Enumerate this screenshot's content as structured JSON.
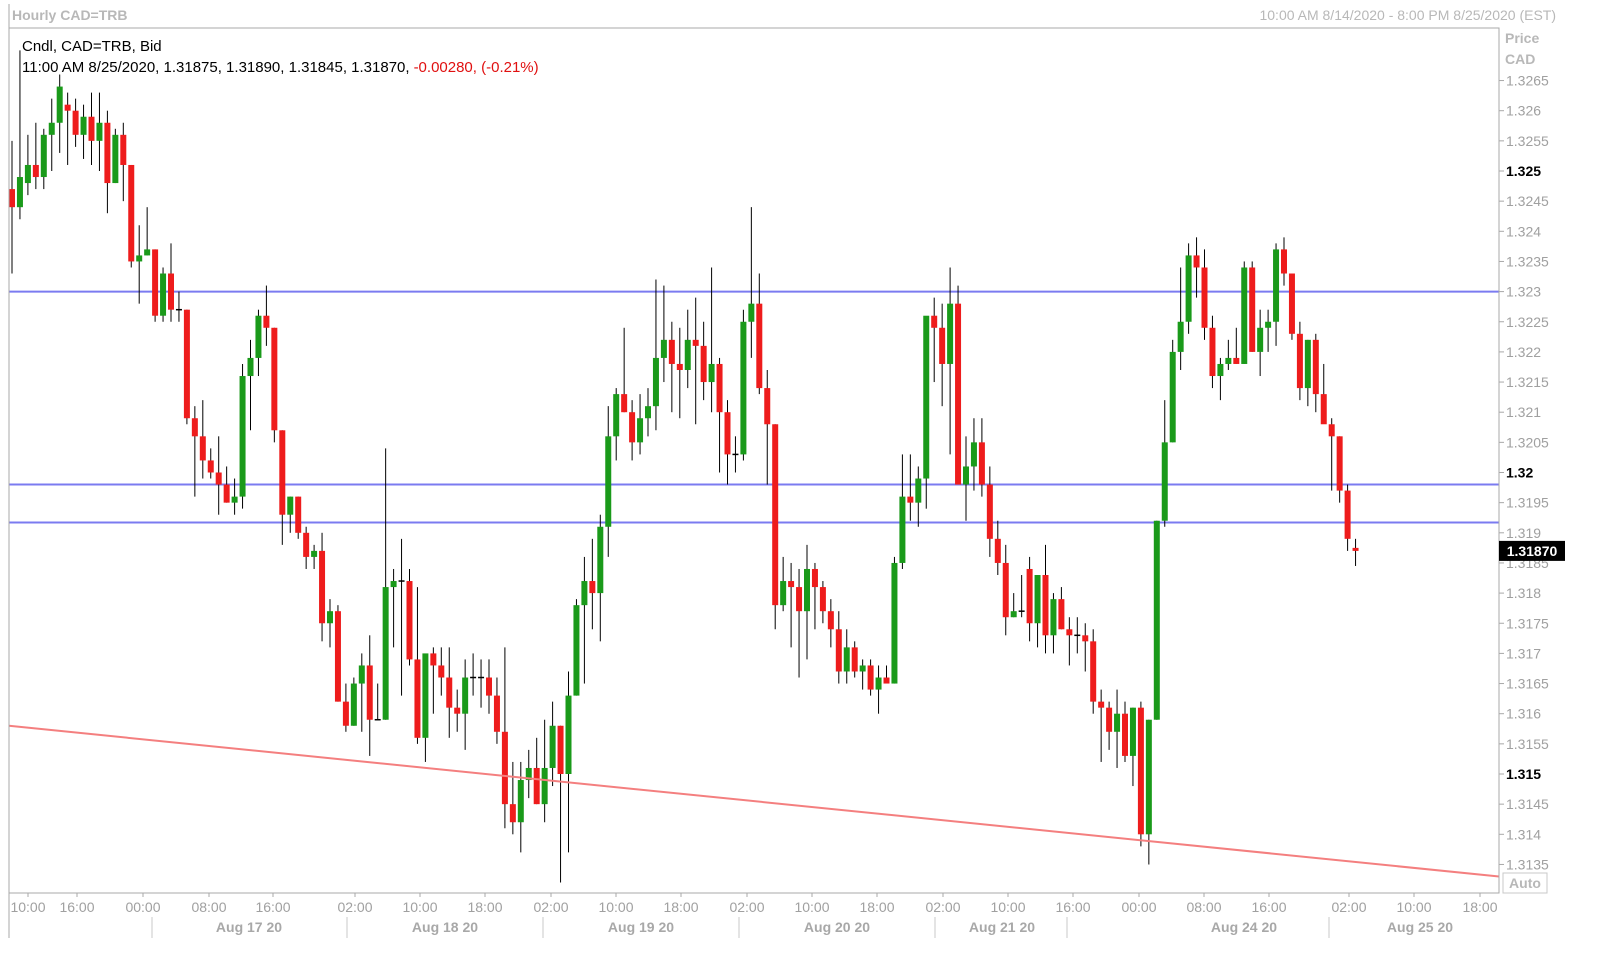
{
  "header": {
    "title": "Hourly CAD=TRB",
    "range": "10:00 AM 8/14/2020 - 8:00 PM 8/25/2020 (EST)"
  },
  "info": {
    "line1": "Cndl, CAD=TRB, Bid",
    "line2_main": "11:00 AM 8/25/2020, 1.31875, 1.31890, 1.31845, 1.31870,",
    "line2_change": "-0.00280, (-0.21%)"
  },
  "price_axis": {
    "title1": "Price",
    "title2": "CAD",
    "ticks": [
      "1.3265",
      "1.326",
      "1.3255",
      "1.325",
      "1.3245",
      "1.324",
      "1.3235",
      "1.323",
      "1.3225",
      "1.322",
      "1.3215",
      "1.321",
      "1.3205",
      "1.32",
      "1.3195",
      "1.319",
      "1.3185",
      "1.318",
      "1.3175",
      "1.317",
      "1.3165",
      "1.316",
      "1.3155",
      "1.315",
      "1.3145",
      "1.314",
      "1.3135"
    ],
    "bold_ticks": [
      "1.325",
      "1.32",
      "1.315"
    ],
    "last_price": "1.31870",
    "auto_label": "Auto"
  },
  "time_axis": {
    "hour_labels": [
      "10:00",
      "16:00",
      "00:00",
      "08:00",
      "16:00",
      "02:00",
      "10:00",
      "18:00",
      "02:00",
      "10:00",
      "18:00",
      "02:00",
      "10:00",
      "18:00",
      "02:00",
      "10:00",
      "16:00",
      "00:00",
      "08:00",
      "16:00",
      "02:00",
      "10:00",
      "18:00"
    ],
    "date_labels": [
      "Aug 17 20",
      "Aug 18 20",
      "Aug 19 20",
      "Aug 20 20",
      "Aug 21 20",
      "Aug 24 20",
      "Aug 25 20"
    ]
  },
  "colors": {
    "up": "#1a9a1a",
    "down": "#ee1c1c",
    "support_resistance": "#7b7bf0",
    "trendline": "#f47f7f",
    "change_text": "#e01010"
  },
  "chart_data": {
    "type": "candlestick",
    "title": "Hourly CAD=TRB",
    "ylabel": "Price CAD",
    "ylim": [
      1.3129,
      1.3273
    ],
    "series_name": "CAD=TRB",
    "candles": [
      {
        "o": 1.3247,
        "h": 1.3255,
        "l": 1.3233,
        "c": 1.3244
      },
      {
        "o": 1.3244,
        "h": 1.327,
        "l": 1.3242,
        "c": 1.3249
      },
      {
        "o": 1.3248,
        "h": 1.3256,
        "l": 1.3246,
        "c": 1.3251
      },
      {
        "o": 1.3251,
        "h": 1.3258,
        "l": 1.3247,
        "c": 1.3249
      },
      {
        "o": 1.3249,
        "h": 1.3257,
        "l": 1.3247,
        "c": 1.3256
      },
      {
        "o": 1.3256,
        "h": 1.3262,
        "l": 1.325,
        "c": 1.3258
      },
      {
        "o": 1.3258,
        "h": 1.3266,
        "l": 1.3253,
        "c": 1.3264
      },
      {
        "o": 1.3261,
        "h": 1.3263,
        "l": 1.3251,
        "c": 1.326
      },
      {
        "o": 1.326,
        "h": 1.3262,
        "l": 1.3254,
        "c": 1.3256
      },
      {
        "o": 1.3256,
        "h": 1.3261,
        "l": 1.3252,
        "c": 1.3259
      },
      {
        "o": 1.3259,
        "h": 1.3263,
        "l": 1.3251,
        "c": 1.3255
      },
      {
        "o": 1.3255,
        "h": 1.3263,
        "l": 1.325,
        "c": 1.3258
      },
      {
        "o": 1.3258,
        "h": 1.326,
        "l": 1.3243,
        "c": 1.3248
      },
      {
        "o": 1.3248,
        "h": 1.3257,
        "l": 1.3248,
        "c": 1.3256
      },
      {
        "o": 1.3256,
        "h": 1.3258,
        "l": 1.3245,
        "c": 1.3251
      },
      {
        "o": 1.3251,
        "h": 1.3251,
        "l": 1.3234,
        "c": 1.3235
      },
      {
        "o": 1.3235,
        "h": 1.3241,
        "l": 1.3228,
        "c": 1.3236
      },
      {
        "o": 1.3236,
        "h": 1.3244,
        "l": 1.3236,
        "c": 1.3237
      },
      {
        "o": 1.3237,
        "h": 1.3237,
        "l": 1.3225,
        "c": 1.3226
      },
      {
        "o": 1.3226,
        "h": 1.3234,
        "l": 1.3225,
        "c": 1.3233
      },
      {
        "o": 1.3233,
        "h": 1.3238,
        "l": 1.3225,
        "c": 1.3227
      },
      {
        "o": 1.3227,
        "h": 1.323,
        "l": 1.3225,
        "c": 1.3227
      },
      {
        "o": 1.3227,
        "h": 1.3227,
        "l": 1.3208,
        "c": 1.3209
      },
      {
        "o": 1.3209,
        "h": 1.3211,
        "l": 1.3196,
        "c": 1.3206
      },
      {
        "o": 1.3206,
        "h": 1.3212,
        "l": 1.3199,
        "c": 1.3202
      },
      {
        "o": 1.3202,
        "h": 1.3204,
        "l": 1.3199,
        "c": 1.32
      },
      {
        "o": 1.32,
        "h": 1.3206,
        "l": 1.3193,
        "c": 1.3198
      },
      {
        "o": 1.3198,
        "h": 1.3201,
        "l": 1.3195,
        "c": 1.3195
      },
      {
        "o": 1.3195,
        "h": 1.3199,
        "l": 1.3193,
        "c": 1.3196
      },
      {
        "o": 1.3196,
        "h": 1.3218,
        "l": 1.3194,
        "c": 1.3216
      },
      {
        "o": 1.3216,
        "h": 1.3222,
        "l": 1.3207,
        "c": 1.3219
      },
      {
        "o": 1.3219,
        "h": 1.3227,
        "l": 1.3216,
        "c": 1.3226
      },
      {
        "o": 1.3226,
        "h": 1.3231,
        "l": 1.3221,
        "c": 1.3224
      },
      {
        "o": 1.3224,
        "h": 1.3224,
        "l": 1.3205,
        "c": 1.3207
      },
      {
        "o": 1.3207,
        "h": 1.3207,
        "l": 1.3188,
        "c": 1.3193
      },
      {
        "o": 1.3193,
        "h": 1.3196,
        "l": 1.319,
        "c": 1.3196
      },
      {
        "o": 1.3196,
        "h": 1.3196,
        "l": 1.3189,
        "c": 1.319
      },
      {
        "o": 1.319,
        "h": 1.3191,
        "l": 1.3184,
        "c": 1.3186
      },
      {
        "o": 1.3186,
        "h": 1.3188,
        "l": 1.3184,
        "c": 1.3187
      },
      {
        "o": 1.3187,
        "h": 1.319,
        "l": 1.3172,
        "c": 1.3175
      },
      {
        "o": 1.3175,
        "h": 1.3179,
        "l": 1.3171,
        "c": 1.3177
      },
      {
        "o": 1.3177,
        "h": 1.3178,
        "l": 1.3162,
        "c": 1.3162
      },
      {
        "o": 1.3162,
        "h": 1.3165,
        "l": 1.3157,
        "c": 1.3158
      },
      {
        "o": 1.3158,
        "h": 1.3166,
        "l": 1.3158,
        "c": 1.3165
      },
      {
        "o": 1.3165,
        "h": 1.317,
        "l": 1.3157,
        "c": 1.3168
      },
      {
        "o": 1.3168,
        "h": 1.3173,
        "l": 1.3153,
        "c": 1.3159
      },
      {
        "o": 1.3159,
        "h": 1.3165,
        "l": 1.3159,
        "c": 1.3159
      },
      {
        "o": 1.3159,
        "h": 1.3204,
        "l": 1.3159,
        "c": 1.3181
      },
      {
        "o": 1.3181,
        "h": 1.3184,
        "l": 1.3171,
        "c": 1.3182
      },
      {
        "o": 1.3182,
        "h": 1.3189,
        "l": 1.3163,
        "c": 1.3182
      },
      {
        "o": 1.3182,
        "h": 1.3184,
        "l": 1.3168,
        "c": 1.3169
      },
      {
        "o": 1.3169,
        "h": 1.3181,
        "l": 1.3155,
        "c": 1.3156
      },
      {
        "o": 1.3156,
        "h": 1.3169,
        "l": 1.3152,
        "c": 1.317
      },
      {
        "o": 1.317,
        "h": 1.3171,
        "l": 1.316,
        "c": 1.3168
      },
      {
        "o": 1.3168,
        "h": 1.3171,
        "l": 1.3163,
        "c": 1.3166
      },
      {
        "o": 1.3166,
        "h": 1.3171,
        "l": 1.3156,
        "c": 1.3161
      },
      {
        "o": 1.3161,
        "h": 1.3164,
        "l": 1.3157,
        "c": 1.316
      },
      {
        "o": 1.316,
        "h": 1.3169,
        "l": 1.3154,
        "c": 1.3166
      },
      {
        "o": 1.3166,
        "h": 1.317,
        "l": 1.3163,
        "c": 1.3166
      },
      {
        "o": 1.3166,
        "h": 1.3169,
        "l": 1.3161,
        "c": 1.3166
      },
      {
        "o": 1.3166,
        "h": 1.3169,
        "l": 1.316,
        "c": 1.3163
      },
      {
        "o": 1.3163,
        "h": 1.3166,
        "l": 1.3155,
        "c": 1.3157
      },
      {
        "o": 1.3157,
        "h": 1.3171,
        "l": 1.3141,
        "c": 1.3145
      },
      {
        "o": 1.3145,
        "h": 1.3152,
        "l": 1.314,
        "c": 1.3142
      },
      {
        "o": 1.3142,
        "h": 1.3152,
        "l": 1.3137,
        "c": 1.3149
      },
      {
        "o": 1.3149,
        "h": 1.3154,
        "l": 1.3146,
        "c": 1.3151
      },
      {
        "o": 1.3151,
        "h": 1.3156,
        "l": 1.3145,
        "c": 1.3145
      },
      {
        "o": 1.3145,
        "h": 1.3159,
        "l": 1.3142,
        "c": 1.3151
      },
      {
        "o": 1.3151,
        "h": 1.3162,
        "l": 1.3148,
        "c": 1.3158
      },
      {
        "o": 1.3158,
        "h": 1.3158,
        "l": 1.3132,
        "c": 1.315
      },
      {
        "o": 1.315,
        "h": 1.3167,
        "l": 1.3137,
        "c": 1.3163
      },
      {
        "o": 1.3163,
        "h": 1.3179,
        "l": 1.3163,
        "c": 1.3178
      },
      {
        "o": 1.3178,
        "h": 1.3186,
        "l": 1.3165,
        "c": 1.3182
      },
      {
        "o": 1.3182,
        "h": 1.3189,
        "l": 1.3174,
        "c": 1.318
      },
      {
        "o": 1.318,
        "h": 1.3193,
        "l": 1.3172,
        "c": 1.3191
      },
      {
        "o": 1.3191,
        "h": 1.3211,
        "l": 1.3186,
        "c": 1.3206
      },
      {
        "o": 1.3206,
        "h": 1.3214,
        "l": 1.3202,
        "c": 1.3213
      },
      {
        "o": 1.3213,
        "h": 1.3224,
        "l": 1.321,
        "c": 1.321
      },
      {
        "o": 1.321,
        "h": 1.3212,
        "l": 1.3202,
        "c": 1.3205
      },
      {
        "o": 1.3205,
        "h": 1.3213,
        "l": 1.3203,
        "c": 1.3209
      },
      {
        "o": 1.3209,
        "h": 1.3214,
        "l": 1.3206,
        "c": 1.3211
      },
      {
        "o": 1.3211,
        "h": 1.3232,
        "l": 1.3207,
        "c": 1.3219
      },
      {
        "o": 1.3219,
        "h": 1.3231,
        "l": 1.3215,
        "c": 1.3222
      },
      {
        "o": 1.3222,
        "h": 1.3225,
        "l": 1.321,
        "c": 1.3218
      },
      {
        "o": 1.3218,
        "h": 1.3224,
        "l": 1.3209,
        "c": 1.3217
      },
      {
        "o": 1.3217,
        "h": 1.3227,
        "l": 1.3214,
        "c": 1.3222
      },
      {
        "o": 1.3222,
        "h": 1.3229,
        "l": 1.3208,
        "c": 1.3221
      },
      {
        "o": 1.3221,
        "h": 1.3225,
        "l": 1.3212,
        "c": 1.3215
      },
      {
        "o": 1.3215,
        "h": 1.3234,
        "l": 1.321,
        "c": 1.3218
      },
      {
        "o": 1.3218,
        "h": 1.3219,
        "l": 1.32,
        "c": 1.321
      },
      {
        "o": 1.321,
        "h": 1.3212,
        "l": 1.3198,
        "c": 1.3203
      },
      {
        "o": 1.3203,
        "h": 1.3206,
        "l": 1.32,
        "c": 1.3203
      },
      {
        "o": 1.3203,
        "h": 1.3227,
        "l": 1.3202,
        "c": 1.3225
      },
      {
        "o": 1.3225,
        "h": 1.3244,
        "l": 1.3219,
        "c": 1.3228
      },
      {
        "o": 1.3228,
        "h": 1.3233,
        "l": 1.3213,
        "c": 1.3214
      },
      {
        "o": 1.3214,
        "h": 1.3217,
        "l": 1.3198,
        "c": 1.3208
      },
      {
        "o": 1.3208,
        "h": 1.3208,
        "l": 1.3174,
        "c": 1.3178
      },
      {
        "o": 1.3178,
        "h": 1.3186,
        "l": 1.3177,
        "c": 1.3182
      },
      {
        "o": 1.3182,
        "h": 1.3185,
        "l": 1.3171,
        "c": 1.3181
      },
      {
        "o": 1.3181,
        "h": 1.3184,
        "l": 1.3166,
        "c": 1.3177
      },
      {
        "o": 1.3177,
        "h": 1.3188,
        "l": 1.3169,
        "c": 1.3184
      },
      {
        "o": 1.3184,
        "h": 1.3185,
        "l": 1.3174,
        "c": 1.3181
      },
      {
        "o": 1.3181,
        "h": 1.3182,
        "l": 1.3175,
        "c": 1.3177
      },
      {
        "o": 1.3177,
        "h": 1.3179,
        "l": 1.3171,
        "c": 1.3174
      },
      {
        "o": 1.3174,
        "h": 1.3177,
        "l": 1.3165,
        "c": 1.3167
      },
      {
        "o": 1.3167,
        "h": 1.3174,
        "l": 1.3165,
        "c": 1.3171
      },
      {
        "o": 1.3171,
        "h": 1.3172,
        "l": 1.3166,
        "c": 1.3167
      },
      {
        "o": 1.3167,
        "h": 1.3169,
        "l": 1.3164,
        "c": 1.3168
      },
      {
        "o": 1.3168,
        "h": 1.3169,
        "l": 1.3163,
        "c": 1.3164
      },
      {
        "o": 1.3164,
        "h": 1.3168,
        "l": 1.316,
        "c": 1.3166
      },
      {
        "o": 1.3166,
        "h": 1.3168,
        "l": 1.3165,
        "c": 1.3165
      },
      {
        "o": 1.3165,
        "h": 1.3186,
        "l": 1.3165,
        "c": 1.3185
      },
      {
        "o": 1.3185,
        "h": 1.3203,
        "l": 1.3184,
        "c": 1.3196
      },
      {
        "o": 1.3196,
        "h": 1.3203,
        "l": 1.3192,
        "c": 1.3195
      },
      {
        "o": 1.3195,
        "h": 1.3201,
        "l": 1.3191,
        "c": 1.3199
      },
      {
        "o": 1.3199,
        "h": 1.3214,
        "l": 1.3194,
        "c": 1.3226
      },
      {
        "o": 1.3226,
        "h": 1.3229,
        "l": 1.3215,
        "c": 1.3224
      },
      {
        "o": 1.3224,
        "h": 1.3228,
        "l": 1.3211,
        "c": 1.3218
      },
      {
        "o": 1.3218,
        "h": 1.3234,
        "l": 1.3203,
        "c": 1.3228
      },
      {
        "o": 1.3228,
        "h": 1.3231,
        "l": 1.3198,
        "c": 1.3198
      },
      {
        "o": 1.3198,
        "h": 1.3206,
        "l": 1.3192,
        "c": 1.3201
      },
      {
        "o": 1.3201,
        "h": 1.3209,
        "l": 1.3197,
        "c": 1.3205
      },
      {
        "o": 1.3205,
        "h": 1.3209,
        "l": 1.3196,
        "c": 1.3198
      },
      {
        "o": 1.3198,
        "h": 1.3201,
        "l": 1.3186,
        "c": 1.3189
      },
      {
        "o": 1.3189,
        "h": 1.3192,
        "l": 1.3183,
        "c": 1.3185
      },
      {
        "o": 1.3185,
        "h": 1.3188,
        "l": 1.3173,
        "c": 1.3176
      },
      {
        "o": 1.3176,
        "h": 1.318,
        "l": 1.3176,
        "c": 1.3177
      },
      {
        "o": 1.3177,
        "h": 1.3183,
        "l": 1.3176,
        "c": 1.3177
      },
      {
        "o": 1.3184,
        "h": 1.3186,
        "l": 1.3172,
        "c": 1.3175
      },
      {
        "o": 1.3175,
        "h": 1.3183,
        "l": 1.3171,
        "c": 1.3183
      },
      {
        "o": 1.3183,
        "h": 1.3188,
        "l": 1.317,
        "c": 1.3173
      },
      {
        "o": 1.3173,
        "h": 1.318,
        "l": 1.317,
        "c": 1.3179
      },
      {
        "o": 1.3179,
        "h": 1.3181,
        "l": 1.3174,
        "c": 1.3174
      },
      {
        "o": 1.3174,
        "h": 1.3176,
        "l": 1.3168,
        "c": 1.3173
      },
      {
        "o": 1.3173,
        "h": 1.3176,
        "l": 1.317,
        "c": 1.3173
      },
      {
        "o": 1.3173,
        "h": 1.3175,
        "l": 1.3167,
        "c": 1.3172
      },
      {
        "o": 1.3172,
        "h": 1.3174,
        "l": 1.316,
        "c": 1.3162
      },
      {
        "o": 1.3162,
        "h": 1.3164,
        "l": 1.3152,
        "c": 1.3161
      },
      {
        "o": 1.3161,
        "h": 1.3162,
        "l": 1.3154,
        "c": 1.3157
      },
      {
        "o": 1.3157,
        "h": 1.3164,
        "l": 1.3151,
        "c": 1.316
      },
      {
        "o": 1.316,
        "h": 1.3162,
        "l": 1.3152,
        "c": 1.3153
      },
      {
        "o": 1.3153,
        "h": 1.3161,
        "l": 1.3148,
        "c": 1.3161
      },
      {
        "o": 1.3161,
        "h": 1.3162,
        "l": 1.3138,
        "c": 1.314
      },
      {
        "o": 1.314,
        "h": 1.3159,
        "l": 1.3135,
        "c": 1.3159
      },
      {
        "o": 1.3159,
        "h": 1.3192,
        "l": 1.3159,
        "c": 1.3192
      },
      {
        "o": 1.3192,
        "h": 1.3212,
        "l": 1.3191,
        "c": 1.3205
      },
      {
        "o": 1.3205,
        "h": 1.3222,
        "l": 1.3205,
        "c": 1.322
      },
      {
        "o": 1.322,
        "h": 1.3234,
        "l": 1.3217,
        "c": 1.3225
      },
      {
        "o": 1.3225,
        "h": 1.3238,
        "l": 1.3223,
        "c": 1.3236
      },
      {
        "o": 1.3236,
        "h": 1.3239,
        "l": 1.3229,
        "c": 1.3234
      },
      {
        "o": 1.3234,
        "h": 1.3237,
        "l": 1.3222,
        "c": 1.3224
      },
      {
        "o": 1.3224,
        "h": 1.3226,
        "l": 1.3214,
        "c": 1.3216
      },
      {
        "o": 1.3216,
        "h": 1.3219,
        "l": 1.3212,
        "c": 1.3218
      },
      {
        "o": 1.3218,
        "h": 1.3222,
        "l": 1.3217,
        "c": 1.3219
      },
      {
        "o": 1.3219,
        "h": 1.3224,
        "l": 1.3218,
        "c": 1.3218
      },
      {
        "o": 1.3218,
        "h": 1.3235,
        "l": 1.3218,
        "c": 1.3234
      },
      {
        "o": 1.3234,
        "h": 1.3235,
        "l": 1.322,
        "c": 1.322
      },
      {
        "o": 1.322,
        "h": 1.3227,
        "l": 1.3216,
        "c": 1.3224
      },
      {
        "o": 1.3224,
        "h": 1.3227,
        "l": 1.322,
        "c": 1.3225
      },
      {
        "o": 1.3225,
        "h": 1.3238,
        "l": 1.3221,
        "c": 1.3237
      },
      {
        "o": 1.3237,
        "h": 1.3239,
        "l": 1.3231,
        "c": 1.3233
      },
      {
        "o": 1.3233,
        "h": 1.3233,
        "l": 1.3222,
        "c": 1.3223
      },
      {
        "o": 1.3223,
        "h": 1.3225,
        "l": 1.3212,
        "c": 1.3214
      },
      {
        "o": 1.3214,
        "h": 1.3222,
        "l": 1.3211,
        "c": 1.3222
      },
      {
        "o": 1.3222,
        "h": 1.3223,
        "l": 1.321,
        "c": 1.3213
      },
      {
        "o": 1.3213,
        "h": 1.3218,
        "l": 1.3209,
        "c": 1.3208
      },
      {
        "o": 1.3208,
        "h": 1.3209,
        "l": 1.3197,
        "c": 1.3206
      },
      {
        "o": 1.3206,
        "h": 1.3206,
        "l": 1.3195,
        "c": 1.3197
      },
      {
        "o": 1.3197,
        "h": 1.3198,
        "l": 1.3187,
        "c": 1.3189
      },
      {
        "o": 1.31875,
        "h": 1.3189,
        "l": 1.31845,
        "c": 1.3187
      }
    ],
    "horizontal_lines": [
      1.323,
      1.3198,
      1.31917
    ],
    "trendline": {
      "from": 1.3158,
      "to": 1.3133
    }
  }
}
